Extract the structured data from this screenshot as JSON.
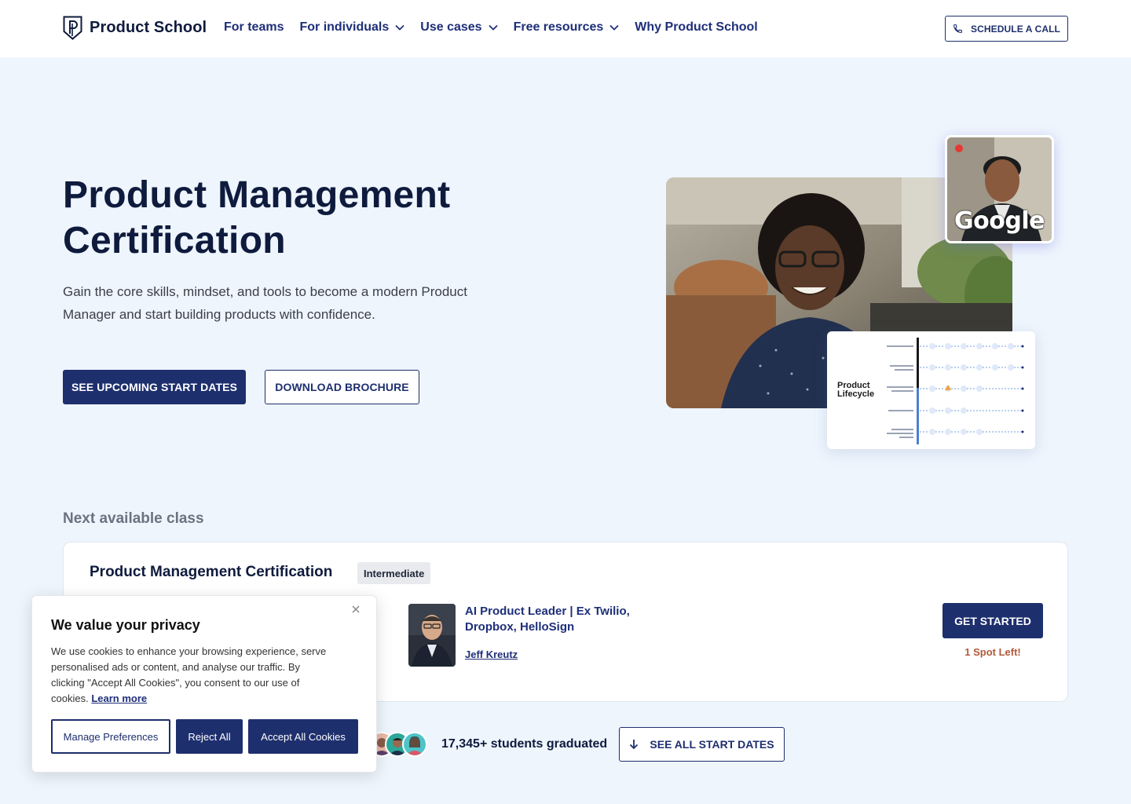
{
  "header": {
    "logo_text": "Product School",
    "nav": [
      {
        "label": "For teams",
        "has_dropdown": false
      },
      {
        "label": "For individuals",
        "has_dropdown": true
      },
      {
        "label": "Use cases",
        "has_dropdown": true
      },
      {
        "label": "Free resources",
        "has_dropdown": true
      },
      {
        "label": "Why Product School",
        "has_dropdown": false
      }
    ],
    "schedule_label": "SCHEDULE A CALL"
  },
  "hero": {
    "title_line1": "Product Management",
    "title_line2": "Certification",
    "subtitle": "Gain the core skills, mindset, and tools to become a modern Product Manager and start building products with confidence.",
    "primary_button": "SEE UPCOMING START DATES",
    "secondary_button": "DOWNLOAD BROCHURE",
    "google_badge": "Google",
    "lifecycle_label": "Product Lifecycle"
  },
  "next_class": {
    "section_label": "Next available class",
    "title": "Product Management Certification",
    "level_badge": "Intermediate",
    "instructor_role": "AI Product Leader | Ex Twilio, Dropbox, HelloSign",
    "instructor_name": "Jeff Kreutz",
    "cta": "GET STARTED",
    "spots": "1 Spot Left!"
  },
  "graduates": {
    "count_text": "17,345+ students graduated",
    "see_all": "SEE ALL START DATES"
  },
  "cookie": {
    "title": "We value your privacy",
    "body": "We use cookies to enhance your browsing experience, serve personalised ads or content, and analyse our traffic. By clicking \"Accept All Cookies\", you consent to our use of cookies.",
    "learn_more": "Learn more",
    "manage": "Manage Preferences",
    "reject": "Reject All",
    "accept": "Accept All Cookies"
  },
  "colors": {
    "brand_navy": "#1e2f6e",
    "page_bg": "#eef5fd",
    "accent_spots": "#b25a3b"
  }
}
